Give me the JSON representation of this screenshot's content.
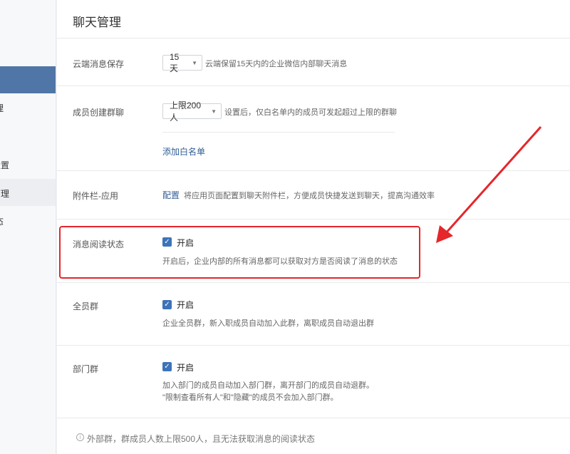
{
  "sidebar": {
    "items": [
      {
        "label": ""
      },
      {
        "label": "理"
      },
      {
        "label": "设置"
      },
      {
        "label": "管理"
      },
      {
        "label": "态"
      }
    ]
  },
  "main": {
    "title": "聊天管理",
    "cloud_save": {
      "label": "云端消息保存",
      "select_value": "15天",
      "desc": "云端保留15天内的企业微信内部聊天消息"
    },
    "create_group": {
      "label": "成员创建群聊",
      "select_value": "上限200人",
      "desc": "设置后，仅白名单内的成员可发起超过上限的群聊",
      "whitelist_link": "添加白名单"
    },
    "attachment": {
      "label": "附件栏-应用",
      "config_link": "配置",
      "desc": "将应用页面配置到聊天附件栏，方便成员快捷发送到聊天，提高沟通效率"
    },
    "read_status": {
      "label": "消息阅读状态",
      "checkbox_label": "开启",
      "checked": true,
      "desc": "开启后，企业内部的所有消息都可以获取对方是否阅读了消息的状态"
    },
    "all_staff": {
      "label": "全员群",
      "checkbox_label": "开启",
      "checked": true,
      "desc": "企业全员群，新入职成员自动加入此群，离职成员自动退出群"
    },
    "dept_group": {
      "label": "部门群",
      "checkbox_label": "开启",
      "checked": true,
      "desc1": "加入部门的成员自动加入部门群，离开部门的成员自动退群。",
      "desc2": "\"限制查看所有人\"和\"隐藏\"的成员不会加入部门群。"
    },
    "footer_note": "外部群，群成员人数上限500人，且无法获取消息的阅读状态"
  },
  "colors": {
    "sidebar_active": "#4f76a7",
    "checkbox": "#3d73b9",
    "link": "#2f5d96",
    "highlight": "#e5262b"
  }
}
